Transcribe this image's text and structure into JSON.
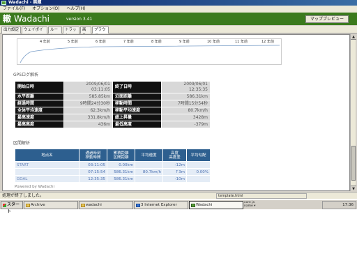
{
  "window": {
    "title": "Wadachi - 無題"
  },
  "menu": [
    "ファイル(F)",
    "オプション(O)",
    "ヘルプ(H)"
  ],
  "banner": {
    "kanji": "轍",
    "name": "Wadachi",
    "version": "version 3.41",
    "map_button": "マッププレビュー"
  },
  "tabs": [
    "出力設定",
    "ウェイポイント",
    "ルート",
    "トラック",
    "画像",
    "ブラウザ"
  ],
  "graph": {
    "ticks": [
      "4 年前",
      "5 年前",
      "6 年前",
      "7 年前",
      "8 年前",
      "9 年前",
      "10 年前",
      "11 年前",
      "12 年前"
    ]
  },
  "gps": {
    "title": "GPSログ解析",
    "rows": [
      {
        "l1": "開始日時",
        "v1": "2009/06/01 03:11:05",
        "l2": "終了日時",
        "v2": "2009/06/01 12:35:35"
      },
      {
        "l1": "水平距離",
        "v1": "585.85km",
        "l2": "沿面距離",
        "v2": "586.31km"
      },
      {
        "l1": "経過時間",
        "v1": "9時間24分30秒",
        "l2": "移動時間",
        "v2": "7時間15分54秒"
      },
      {
        "l1": "全体平均速度",
        "v1": "62.3km/h",
        "l2": "移動平均速度",
        "v2": "80.7km/h"
      },
      {
        "l1": "最高速度",
        "v1": "331.8km/h",
        "l2": "総上昇量",
        "v2": "3428m"
      },
      {
        "l1": "最高高度",
        "v1": "436m",
        "l2": "最低高度",
        "v2": "-379m"
      }
    ]
  },
  "sections": {
    "title": "区間解析",
    "headers": [
      "地点名",
      "通過時刻\n移動時間",
      "累積距離\n区間距離",
      "平均速度",
      "高度\n高度差",
      "平均勾配"
    ],
    "rows": [
      [
        "START",
        "03:11:05",
        "0.00km",
        "",
        "-12m",
        ""
      ],
      [
        "",
        "07:15:54",
        "586.31km",
        "80.7km/h",
        "↑3m",
        "0.00%"
      ],
      [
        "GOAL",
        "12:35:35",
        "586.31km",
        "",
        "-10m",
        ""
      ]
    ],
    "powered": "Powered by Wadachi"
  },
  "status": {
    "text": "処理が終了しました。",
    "url": "template.html"
  },
  "taskbar": {
    "start": "スタート",
    "tasks": [
      "Archive",
      "wadachi",
      "3 Internet Explorer",
      "Wadachi"
    ],
    "lang": "core ja\nname ▾",
    "clock": "17:36"
  }
}
